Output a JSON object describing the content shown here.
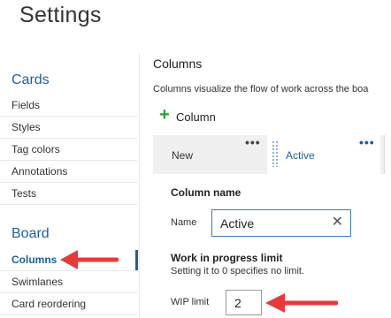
{
  "page": {
    "title": "Settings"
  },
  "sidebar": {
    "cards_header": "Cards",
    "cards_items": [
      "Fields",
      "Styles",
      "Tag colors",
      "Annotations",
      "Tests"
    ],
    "board_header": "Board",
    "board_items": [
      "Columns",
      "Swimlanes",
      "Card reordering"
    ],
    "active_item": "Columns"
  },
  "main": {
    "header": "Columns",
    "description": "Columns visualize the flow of work across the boa",
    "add_column_label": "Column",
    "tabs": [
      {
        "label": "New",
        "menu": "•••"
      },
      {
        "label": "Active",
        "menu": "•••"
      }
    ],
    "column_name_title": "Column name",
    "name_label": "Name",
    "name_value": "Active",
    "wip_title": "Work in progress limit",
    "wip_hint": "Setting it to 0 specifies no limit.",
    "wip_label": "WIP limit",
    "wip_value": "2"
  },
  "icons": {
    "add": "plus-icon",
    "clear": "close-icon",
    "grip": "drag-handle-icon",
    "menu": "ellipsis-icon",
    "annotation": "red-arrow"
  },
  "colors": {
    "accent": "#1f5fa0",
    "plus": "#339933",
    "arrow": "#e8393a"
  }
}
